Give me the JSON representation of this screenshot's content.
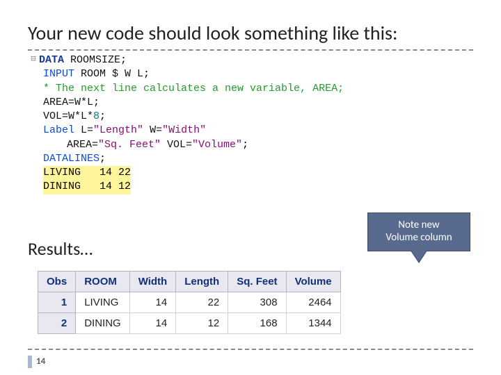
{
  "title": "Your new code should look something like this:",
  "code": {
    "collapse": "⊟",
    "kw_data": "DATA",
    "dsname": "ROOMSIZE",
    "kw_input": "INPUT",
    "input_spec": "ROOM $ W L",
    "comment": "* The next line calculates a new variable, AREA;",
    "area_lhs": "AREA=W*L",
    "vol_lhs": "VOL=W*L*",
    "eight": "8",
    "label_kw": "Label",
    "label1_a": "L=",
    "label1_av": "\"Length\"",
    "label1_b": " W=",
    "label1_bv": "\"Width\"",
    "label2_a": "AREA=",
    "label2_av": "\"Sq. Feet\"",
    "label2_b": " VOL=",
    "label2_bv": "\"Volume\"",
    "datalines": "DATALINES",
    "row1_room": "LIVING",
    "row1_vals": "   14 22",
    "row2_room": "DINING",
    "row2_vals": "   14 12",
    "semi": ";"
  },
  "results_label": "Results…",
  "callout_l1": "Note new",
  "callout_l2": "Volume column",
  "table": {
    "headers": [
      "Obs",
      "ROOM",
      "Width",
      "Length",
      "Sq. Feet",
      "Volume"
    ],
    "rows": [
      {
        "obs": "1",
        "room": "LIVING",
        "w": "14",
        "l": "22",
        "sq": "308",
        "v": "2464"
      },
      {
        "obs": "2",
        "room": "DINING",
        "w": "14",
        "l": "12",
        "sq": "168",
        "v": "1344"
      }
    ]
  },
  "pagenum": "14"
}
